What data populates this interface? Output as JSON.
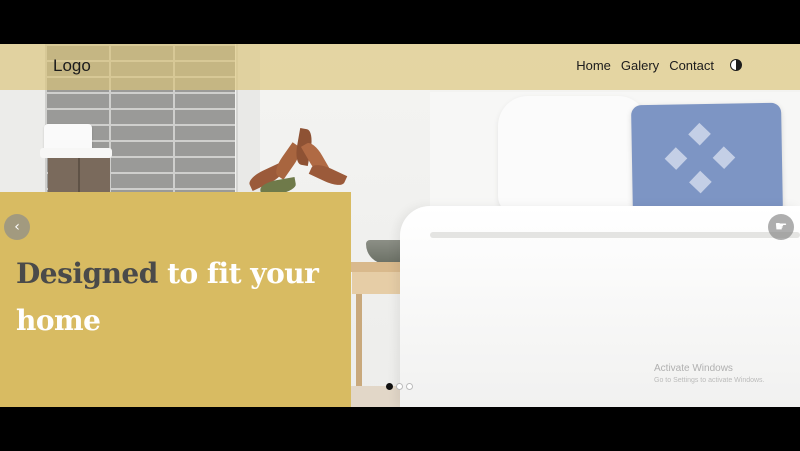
{
  "header": {
    "logo": "Logo",
    "nav": [
      "Home",
      "Galery",
      "Contact"
    ],
    "theme_icon": "half-circle-contrast-icon"
  },
  "hero": {
    "headline_dark": "Designed",
    "headline_light": "to fit your home",
    "prev_icon": "chevron-left-icon",
    "prev_glyph": "‹",
    "next_icon": "hand-pointer-icon",
    "next_glyph": "☛",
    "slides": 3,
    "active_slide": 1
  },
  "watermark": {
    "line1": "Activate Windows",
    "line2": "Go to Settings to activate Windows."
  },
  "colors": {
    "header_bg": "#dcc478",
    "panel_bg": "#d8bb62",
    "headline_dark": "#4a4a4a",
    "headline_light": "#ffffff",
    "pillow_blue": "#7d95c4"
  }
}
